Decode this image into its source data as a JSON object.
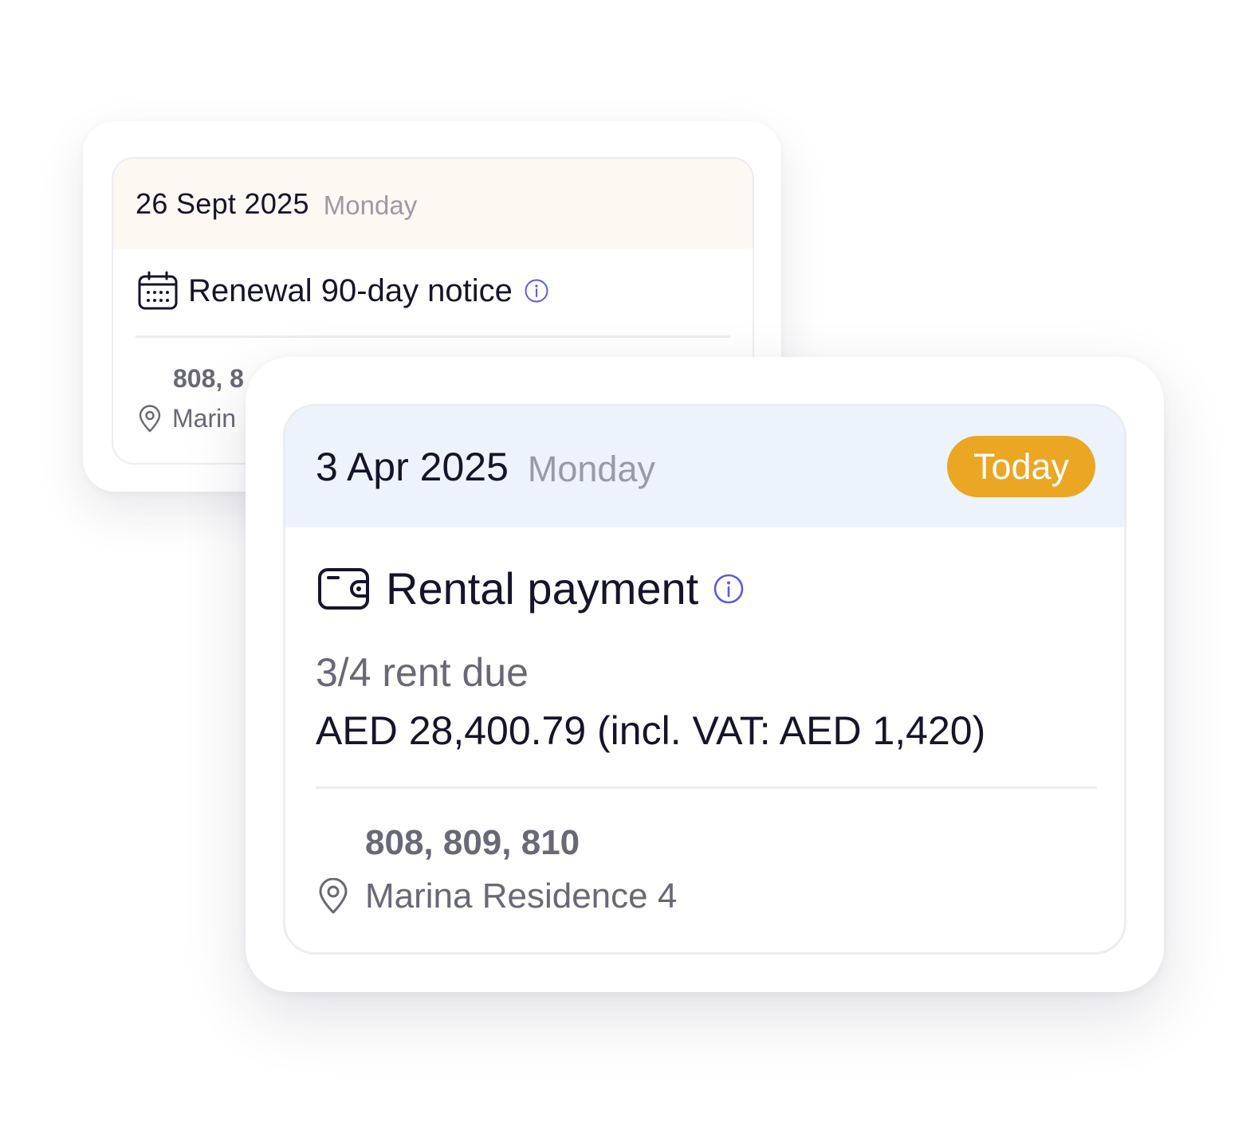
{
  "back_card": {
    "date": "26 Sept 2025",
    "weekday": "Monday",
    "icon": "calendar-icon",
    "title": "Renewal 90-day notice",
    "info_icon": "info-icon",
    "units": "808, 8",
    "location_icon": "location-pin-icon",
    "location": "Marin"
  },
  "front_card": {
    "date": "3 Apr 2025",
    "weekday": "Monday",
    "badge": "Today",
    "icon": "wallet-icon",
    "title": "Rental payment",
    "info_icon": "info-icon",
    "rent_due": "3/4 rent due",
    "amount": "AED 28,400.79 (incl. VAT: AED 1,420)",
    "units": "808, 809, 810",
    "location_icon": "location-pin-icon",
    "location": "Marina Residence 4"
  },
  "colors": {
    "accent_info": "#5b5ce0",
    "badge_bg": "#eba623",
    "back_header_bg": "#fcf8f2",
    "front_header_bg": "#ecf3fd",
    "text_primary": "#15142b",
    "text_secondary": "#686878",
    "text_muted": "#9a9aa7"
  }
}
